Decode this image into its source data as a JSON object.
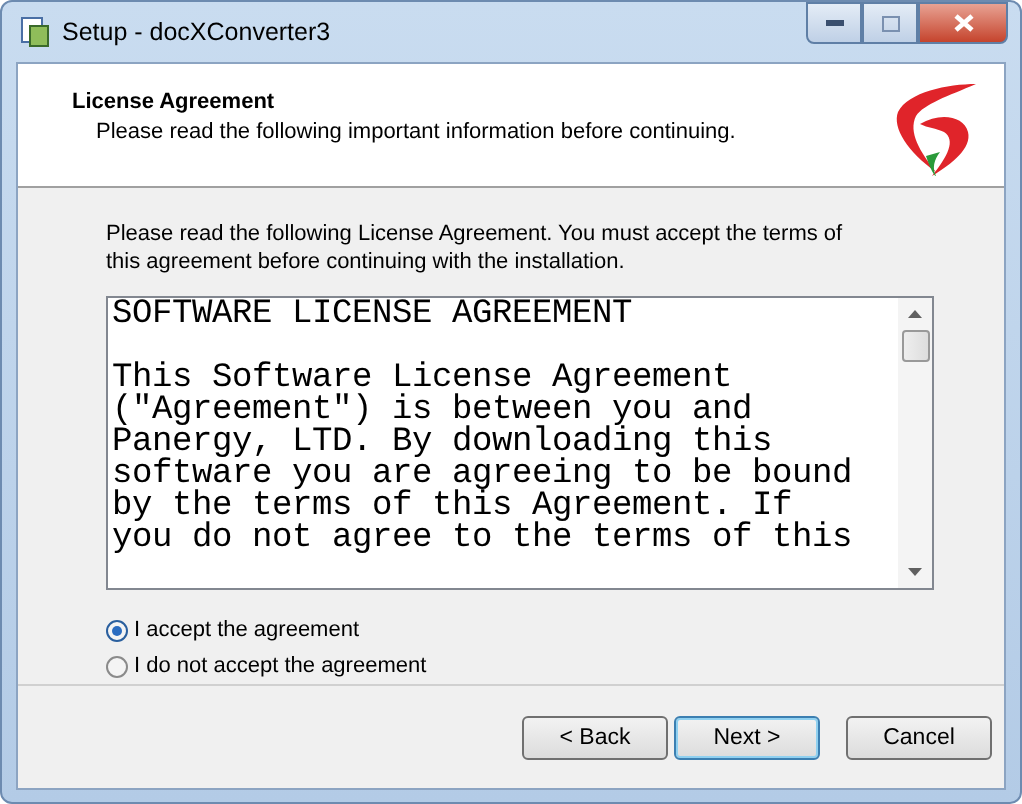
{
  "window": {
    "title": "Setup - docXConverter3"
  },
  "header": {
    "title": "License Agreement",
    "subtitle": "Please read the following important information before continuing."
  },
  "intro": "Please read the following License Agreement. You must accept the terms of this agreement before continuing with the installation.",
  "license_text": "SOFTWARE LICENSE AGREEMENT\n\nThis Software License Agreement\n(\"Agreement\") is between you and\nPanergy, LTD. By downloading this\nsoftware you are agreeing to be bound\nby the terms of this Agreement. If\nyou do not agree to the terms of this",
  "options": [
    {
      "label": "I accept the agreement",
      "selected": true
    },
    {
      "label": "I do not accept the agreement",
      "selected": false
    }
  ],
  "buttons": [
    {
      "label": "< Back",
      "default": false
    },
    {
      "label": "Next >",
      "default": true
    },
    {
      "label": "Cancel",
      "default": false
    }
  ]
}
